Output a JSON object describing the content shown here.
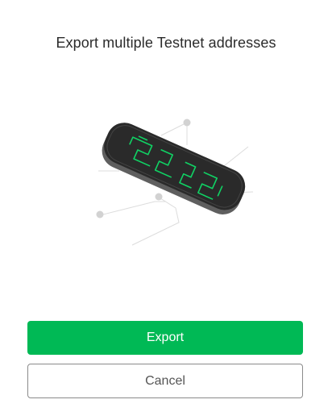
{
  "dialog": {
    "title": "Export multiple Testnet addresses",
    "illustration_icon": "hardware-wallet-key-illustration",
    "accent_color": "#00b955",
    "buttons": {
      "export_label": "Export",
      "cancel_label": "Cancel"
    }
  }
}
